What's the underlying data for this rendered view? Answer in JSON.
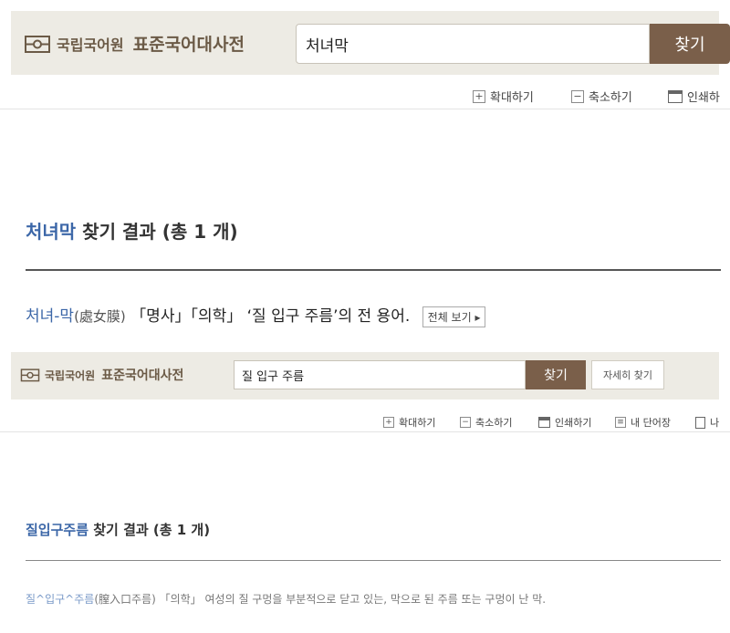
{
  "panel1": {
    "header": {
      "org_name": "국립국어원",
      "dict_name": "표준국어대사전",
      "search_value": "처녀막",
      "search_button": "찾기"
    },
    "toolbar": {
      "zoom_in": "확대하기",
      "zoom_out": "축소하기",
      "print": "인쇄하"
    },
    "result": {
      "query": "처녀막",
      "suffix": "찾기 결과 (총 1 개)"
    },
    "entry": {
      "word": "처녀-막",
      "hanja": "(處女膜)",
      "tags": "「명사」「의학」",
      "definition": "‘질 입구 주름’의 전 용어.",
      "more_button": "전체 보기 ▸"
    }
  },
  "panel2": {
    "header": {
      "org_name": "국립국어원",
      "dict_name": "표준국어대사전",
      "search_value": "질 입구 주름",
      "search_button": "찾기",
      "detail_button": "자세히 찾기"
    },
    "toolbar": {
      "zoom_in": "확대하기",
      "zoom_out": "축소하기",
      "print": "인쇄하기",
      "my_words": "내 단어장",
      "more": "나"
    },
    "result": {
      "query": "질입구주름",
      "suffix": "찾기 결과 (총 1 개)"
    },
    "entry": {
      "word": "질^입구^주름",
      "hanja": "(膣入口주름)",
      "tags": "「의학」",
      "definition": "여성의 질 구멍을 부분적으로 닫고 있는, 막으로 된 주름 또는 구멍이 난 막."
    }
  },
  "colors": {
    "header_bg": "#edebe4",
    "brand_brown": "#7a5f4a",
    "link_blue": "#3c67a8"
  }
}
